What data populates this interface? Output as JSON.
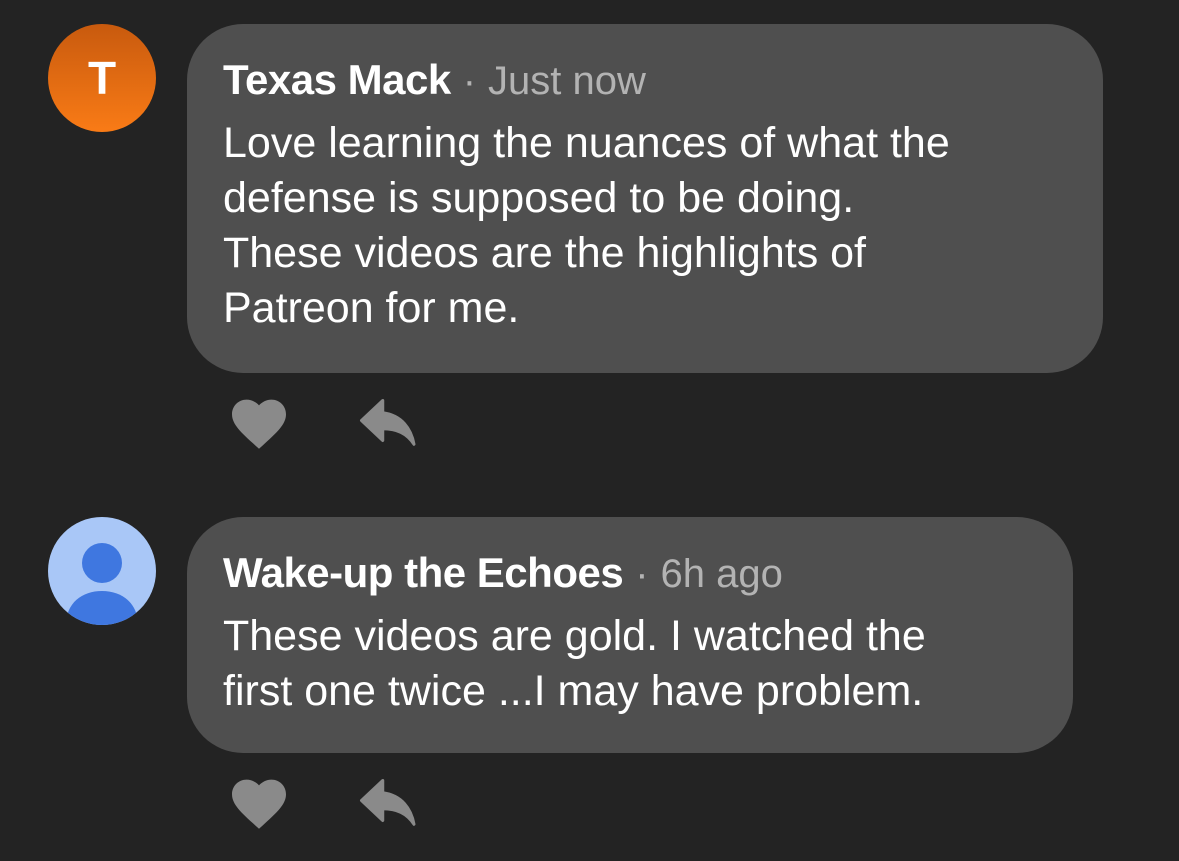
{
  "comments": [
    {
      "avatar_letter": "T",
      "author": "Texas Mack",
      "separator": "·",
      "time": "Just now",
      "text": "Love learning the nuances of what the\ndefense is supposed to be doing.\nThese videos are the highlights of\nPatreon for me."
    },
    {
      "author": "Wake-up the Echoes",
      "separator": "·",
      "time": "6h ago",
      "text": "These videos are gold. I watched the\nfirst one twice ...I may have problem."
    }
  ],
  "icons": {
    "like": "heart-icon",
    "reply": "reply-icon",
    "default_avatar": "person-icon"
  },
  "colors": {
    "background": "#232323",
    "bubble": "#4f4f4f",
    "avatar_orange": "#f97b16",
    "avatar_blue_bg": "#a9c7f7",
    "avatar_blue_fg": "#3f77e0",
    "icon_gray": "#8a8a8a"
  }
}
